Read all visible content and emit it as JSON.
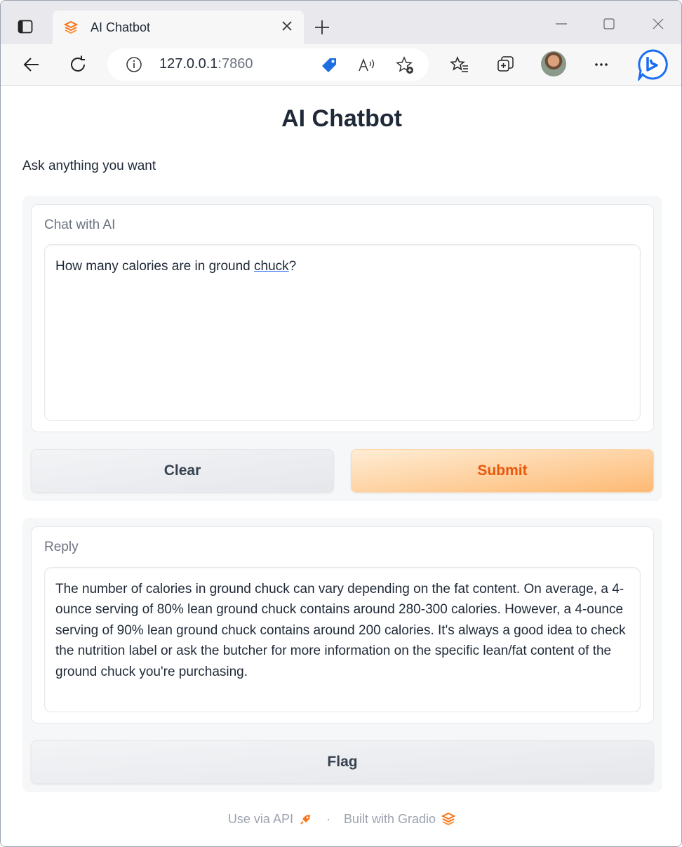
{
  "browser": {
    "tab": {
      "title": "AI Chatbot"
    },
    "address": {
      "host": "127.0.0.1",
      "port": ":7860"
    }
  },
  "app": {
    "title": "AI Chatbot",
    "description": "Ask anything you want",
    "input": {
      "label": "Chat with AI",
      "value_before": "How many calories are in ground ",
      "value_underlined": "chuck",
      "value_after": "?"
    },
    "buttons": {
      "clear": "Clear",
      "submit": "Submit",
      "flag": "Flag"
    },
    "output": {
      "label": "Reply",
      "value": "The number of calories in ground chuck can vary depending on the fat content. On average, a 4-ounce serving of 80% lean ground chuck contains around 280-300 calories. However, a 4-ounce serving of 90% lean ground chuck contains around 200 calories. It's always a good idea to check the nutrition label or ask the butcher for more information on the specific lean/fat content of the ground chuck you're purchasing."
    },
    "footer": {
      "api": "Use via API",
      "separator": "·",
      "built": "Built with Gradio"
    }
  },
  "colors": {
    "accent": "#ea580c",
    "accent_light": "#fdba74",
    "edge_bing": "#1b6ef3"
  },
  "icons": [
    "sidebar-toggle-icon",
    "gradio-logo-icon",
    "close-icon",
    "plus-icon",
    "minimize-icon",
    "maximize-icon",
    "back-icon",
    "refresh-icon",
    "info-icon",
    "tag-icon",
    "read-aloud-icon",
    "add-favorite-icon",
    "favorites-icon",
    "collections-icon",
    "more-icon",
    "bing-icon",
    "rocket-icon"
  ]
}
